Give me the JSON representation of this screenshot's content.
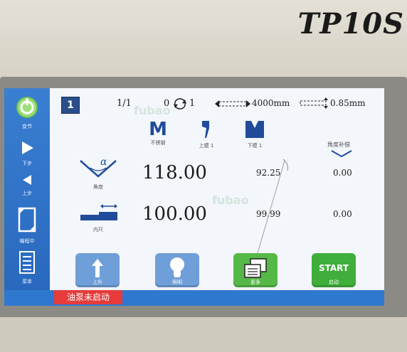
{
  "device": {
    "model": "TP10S"
  },
  "sidebar": {
    "items": [
      {
        "label": "变节"
      },
      {
        "label": "下步"
      },
      {
        "label": "上步"
      },
      {
        "label": "编程中"
      },
      {
        "label": "菜单"
      }
    ]
  },
  "header": {
    "program_number": "1",
    "step": "1/1",
    "cycle_count": "0",
    "cycle_target": "1",
    "length": "4000mm",
    "thickness": "0.85mm"
  },
  "material": {
    "label": "不锈钢"
  },
  "upper_die": {
    "label": "上模 1"
  },
  "lower_die": {
    "label": "下模 1"
  },
  "angle": {
    "label": "角度",
    "symbol": "α",
    "target": "118.00",
    "actual": "92.25",
    "comp_label": "角度补偿",
    "compensation": "0.00"
  },
  "backgauge": {
    "label": "内尺",
    "target": "100.00",
    "actual": "99.99",
    "compensation": "0.00"
  },
  "toolbar": {
    "up_label": "上升",
    "light_label": "照明",
    "more_label": "更多",
    "start_text": "START",
    "start_label": "启动"
  },
  "status": {
    "pump": "油泵未启动"
  },
  "watermark": "fubao",
  "colors": {
    "sidebar": "#2f78d0",
    "button_blue": "#6f9fd8",
    "button_green": "#56b847",
    "start_green": "#3fae3a",
    "alert_red": "#e53b3b"
  }
}
